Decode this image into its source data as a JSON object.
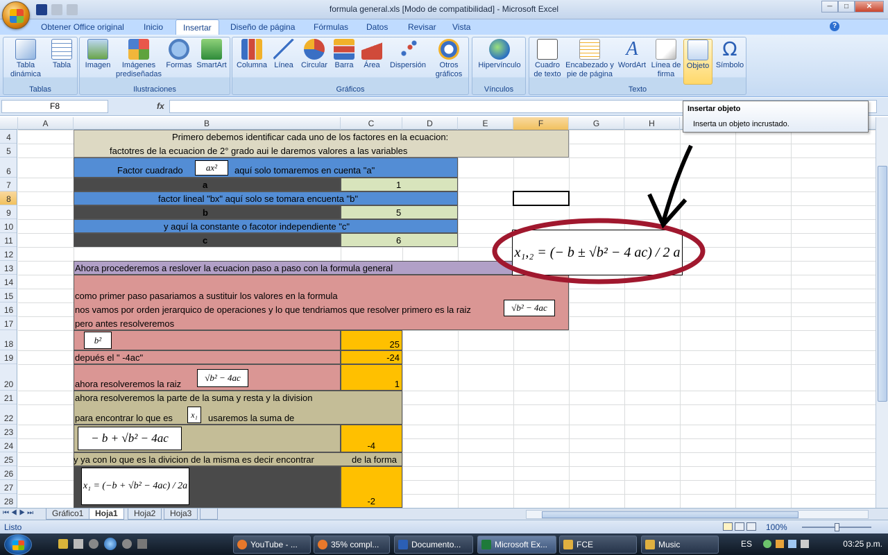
{
  "window": {
    "title": "formula general.xls  [Modo de compatibilidad] - Microsoft Excel",
    "min": "─",
    "max": "□",
    "close": "✕"
  },
  "ribbon_tabs": [
    "Obtener Office original",
    "Inicio",
    "Insertar",
    "Diseño de página",
    "Fórmulas",
    "Datos",
    "Revisar",
    "Vista"
  ],
  "ribbon_groups": {
    "tablas": {
      "label": "Tablas",
      "buttons": [
        "Tabla dinámica",
        "Tabla"
      ]
    },
    "ilustraciones": {
      "label": "Ilustraciones",
      "buttons": [
        "Imagen",
        "Imágenes prediseñadas",
        "Formas",
        "SmartArt"
      ]
    },
    "graficos": {
      "label": "Gráficos",
      "buttons": [
        "Columna",
        "Línea",
        "Circular",
        "Barra",
        "Área",
        "Dispersión",
        "Otros gráficos"
      ]
    },
    "vinculos": {
      "label": "Vínculos",
      "buttons": [
        "Hipervínculo"
      ]
    },
    "texto": {
      "label": "Texto",
      "buttons": [
        "Cuadro de texto",
        "Encabezado y pie de página",
        "WordArt",
        "Línea de firma",
        "Objeto",
        "Símbolo"
      ]
    }
  },
  "formula_bar": {
    "name_box": "F8",
    "fx": "fx",
    "value": ""
  },
  "tooltip": {
    "title": "Insertar objeto",
    "body": "Inserta un objeto incrustado."
  },
  "columns": [
    "A",
    "B",
    "C",
    "D",
    "E",
    "F",
    "G",
    "H",
    "I"
  ],
  "rows": [
    "4",
    "5",
    "6",
    "7",
    "8",
    "9",
    "10",
    "11",
    "12",
    "13",
    "14",
    "15",
    "16",
    "17",
    "18",
    "19",
    "20",
    "21",
    "22",
    "23",
    "24",
    "25",
    "26",
    "27",
    "28"
  ],
  "cells": {
    "r4": "Primero debemos identificar cada uno de los factores en la ecuacion:",
    "r5": "factotres de la ecuacion de 2° grado aui le daremos valores a las variables",
    "r6a": "Factor cuadrado",
    "r6b": "aquí solo tomaremos en cuenta \"a\"",
    "r7_label": "a",
    "r7_val": "1",
    "r8": "factor lineal \"bx\" aquí solo se tomara encuenta \"b\"",
    "r9_label": "b",
    "r9_val": "5",
    "r10": "y aquí  la constante o facotor independiente \"c\"",
    "r11_label": "c",
    "r11_val": "6",
    "r13": "Ahora procederemos a reslover la ecuacion paso a paso con la formula general",
    "r15": "como primer paso pasariamos a sustituir los valores en la formula",
    "r16": "nos vamos por orden jerarquico de operaciones y lo que tendriamos que resolver primero es la raiz",
    "r17": "pero antes resolveremos",
    "r18_val": "25",
    "r19": "depués el \" -4ac\"",
    "r19_val": "-24",
    "r20": "ahora resolveremos la raiz",
    "r20_val": "1",
    "r21": "ahora resolveremos la parte de la suma y resta  y la division",
    "r22a": "para encontrar lo que es",
    "r22b": "usaremos la suma de",
    "r24_val": "-4",
    "r25a": "y ya con lo que es la  divicion de la misma es decir encontrar",
    "r25b": "de la forma",
    "r28_val": "-2"
  },
  "equations": {
    "ax2": "ax²",
    "b2": "b²",
    "sqrt_small": "√b² − 4ac",
    "x1": "x₁",
    "numerator": "− b + √b² − 4ac",
    "x1_formula": "x₁ = (−b + √b² − 4ac) / 2a",
    "general": "x₁,₂ = (− b ± √b² − 4 ac) / 2 a"
  },
  "sheets": [
    "Gráfico1",
    "Hoja1",
    "Hoja2",
    "Hoja3"
  ],
  "status": {
    "ready": "Listo",
    "zoom": "100%"
  },
  "taskbar": {
    "items": [
      "YouTube - ...",
      "35% compl...",
      "Documento...",
      "Microsoft Ex...",
      "FCE",
      "Music"
    ],
    "lang": "ES",
    "clock": "03:25 p.m."
  },
  "colors": {
    "tan": "#ddd9c3",
    "blue": "#538dd5",
    "dark": "#4a4a4a",
    "green": "#d8e4bc",
    "lavender": "#b1a0c7",
    "salmon": "#da9694",
    "orange": "#ffc000",
    "khaki": "#c4bd97",
    "circle": "#a0182e"
  }
}
